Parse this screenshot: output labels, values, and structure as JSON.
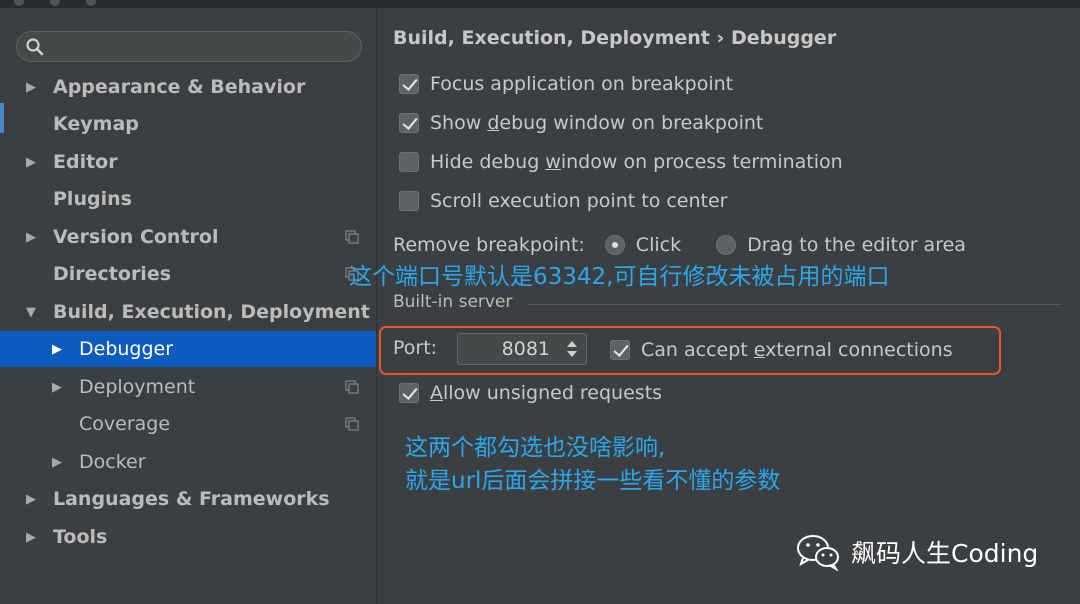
{
  "search": {
    "placeholder": ""
  },
  "sidebar": {
    "items": [
      {
        "label": "Appearance & Behavior",
        "arrow": "▶"
      },
      {
        "label": "Keymap",
        "arrow": ""
      },
      {
        "label": "Editor",
        "arrow": "▶"
      },
      {
        "label": "Plugins",
        "arrow": ""
      },
      {
        "label": "Version Control",
        "arrow": "▶"
      },
      {
        "label": "Directories",
        "arrow": ""
      },
      {
        "label": "Build, Execution, Deployment",
        "arrow": "▼"
      },
      {
        "label": "Debugger",
        "arrow": "▶"
      },
      {
        "label": "Deployment",
        "arrow": "▶"
      },
      {
        "label": "Coverage",
        "arrow": ""
      },
      {
        "label": "Docker",
        "arrow": "▶"
      },
      {
        "label": "Languages & Frameworks",
        "arrow": "▶"
      },
      {
        "label": "Tools",
        "arrow": "▶"
      }
    ]
  },
  "main": {
    "breadcrumb": "Build, Execution, Deployment › Debugger",
    "checkboxes": [
      {
        "pre": "Focus application on breakpoint",
        "u": "",
        "post": "",
        "checked": true
      },
      {
        "pre": "Show ",
        "u": "d",
        "post": "ebug window on breakpoint",
        "checked": true
      },
      {
        "pre": "Hide debug ",
        "u": "w",
        "post": "indow on process termination",
        "checked": false
      },
      {
        "pre": "Scroll execution point to center",
        "u": "",
        "post": "",
        "checked": false
      }
    ],
    "remove_breakpoint": {
      "label": "Remove breakpoint:",
      "option1": "Click",
      "option2": "Drag to the editor area",
      "selected": "Click"
    },
    "builtin_server": {
      "title": "Built-in server",
      "port_label": "Port:",
      "port_value": "8081",
      "external_pre": "Can accept ",
      "external_u": "e",
      "external_post": "xternal connections",
      "external_checked": true,
      "unsigned_u": "A",
      "unsigned_post": "llow unsigned requests",
      "unsigned_checked": true
    }
  },
  "annotations": {
    "port_note": "这个端口号默认是63342,可自行修改未被占用的端口",
    "check_note_1": "这两个都勾选也没啥影响,",
    "check_note_2": "就是url后面会拼接一些看不懂的参数"
  },
  "watermark": {
    "text": "飙码人生Coding"
  },
  "colors": {
    "selection": "#0d5bbd",
    "annotation": "#2aa7ec",
    "highlight_box": "#e8552e",
    "background": "#3c3f41"
  }
}
